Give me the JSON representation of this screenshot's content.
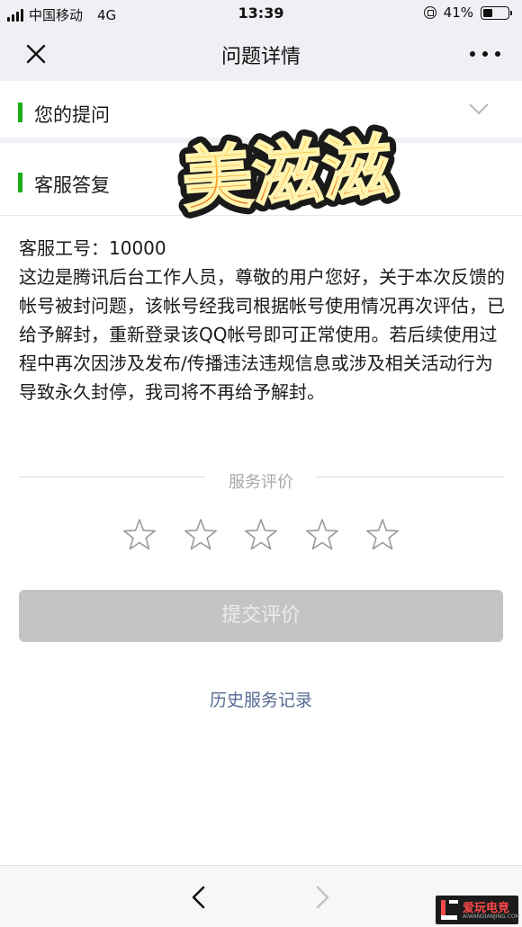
{
  "status_bar": {
    "carrier": "中国移动",
    "network": "4G",
    "time": "13:39",
    "battery_percent": "41%",
    "battery_level": 0.41
  },
  "nav": {
    "title": "问题详情"
  },
  "sections": {
    "question_label": "您的提问",
    "reply_label": "客服答复"
  },
  "sticker": {
    "text": "美滋滋"
  },
  "reply": {
    "agent_id_line": "客服工号：10000",
    "message": "这边是腾讯后台工作人员，尊敬的用户您好，关于本次反馈的帐号被封问题，该帐号经我司根据帐号使用情况再次评估，已给予解封，重新登录该QQ帐号即可正常使用。若后续使用过程中再次因涉及发布/传播违法违规信息或涉及相关活动行为导致永久封停，我司将不再给予解封。"
  },
  "rating": {
    "title": "服务评价",
    "stars_total": 5,
    "stars_selected": 0
  },
  "submit_label": "提交评价",
  "history_link": "历史服务记录",
  "watermark": {
    "text": "爱玩电竞",
    "sub": "AIWANDIANJING.COM"
  },
  "colors": {
    "accent_green": "#1aad19",
    "link_blue": "#576b95",
    "nav_bg": "#efeff4"
  }
}
